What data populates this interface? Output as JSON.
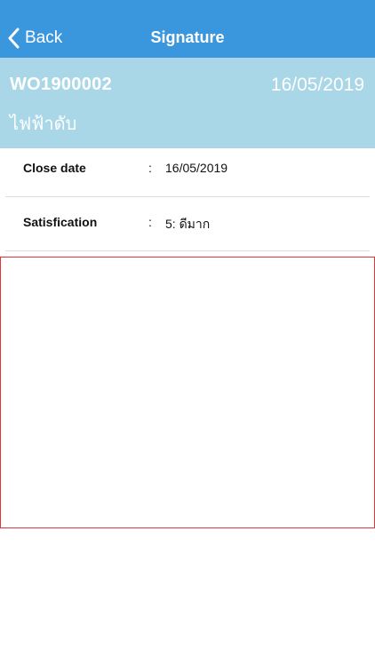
{
  "navbar": {
    "back_label": "Back",
    "title": "Signature",
    "color": "#3a97dd"
  },
  "header": {
    "work_order": "WO1900002",
    "date": "16/05/2019",
    "subtitle": "ไฟฟ้าดับ",
    "background": "#a9d7e7"
  },
  "details": [
    {
      "label": "Close date",
      "separator": ":",
      "value": "16/05/2019"
    },
    {
      "label": "Satisfication",
      "separator": ":",
      "value": "5: ดีมาก"
    }
  ],
  "signature_pad": {
    "border_color": "#e33636"
  }
}
